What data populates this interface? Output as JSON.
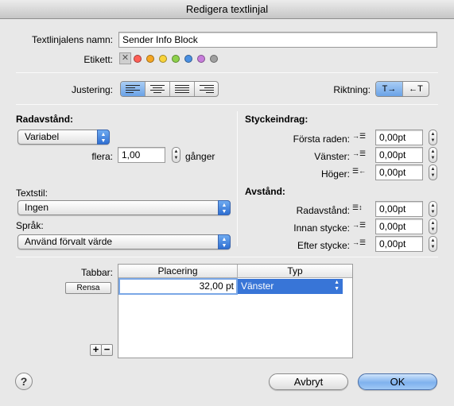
{
  "window": {
    "title": "Redigera textlinjal"
  },
  "name_field": {
    "label": "Textlinjalens namn:",
    "value": "Sender Info Block"
  },
  "tag": {
    "label": "Etikett:",
    "colors": [
      "#ff5f57",
      "#f5a623",
      "#f8d33a",
      "#8ed14b",
      "#4a90e2",
      "#c77ddb",
      "#a0a0a0"
    ]
  },
  "alignment": {
    "label": "Justering:",
    "selected": "left"
  },
  "direction": {
    "label": "Riktning:",
    "ltr": "T→",
    "rtl": "←T"
  },
  "line_spacing": {
    "heading": "Radavstånd:",
    "mode": "Variabel",
    "multiple_label": "flera:",
    "multiple_value": "1,00",
    "unit": "gånger"
  },
  "text_style": {
    "label": "Textstil:",
    "value": "Ingen"
  },
  "language": {
    "label": "Språk:",
    "value": "Använd förvalt värde"
  },
  "indent": {
    "heading": "Styckeindrag:",
    "first_line_label": "Första raden:",
    "first_line_value": "0,00pt",
    "left_label": "Vänster:",
    "left_value": "0,00pt",
    "right_label": "Höger:",
    "right_value": "0,00pt"
  },
  "spacing": {
    "heading": "Avstånd:",
    "line_label": "Radavstånd:",
    "line_value": "0,00pt",
    "before_label": "Innan stycke:",
    "before_value": "0,00pt",
    "after_label": "Efter stycke:",
    "after_value": "0,00pt"
  },
  "tabs": {
    "label": "Tabbar:",
    "clear_button": "Rensa",
    "columns": [
      "Placering",
      "Typ"
    ],
    "rows": [
      {
        "position": "32,00 pt",
        "type": "Vänster"
      }
    ],
    "add_symbol": "+",
    "remove_symbol": "−"
  },
  "footer": {
    "help": "?",
    "cancel": "Avbryt",
    "ok": "OK"
  }
}
